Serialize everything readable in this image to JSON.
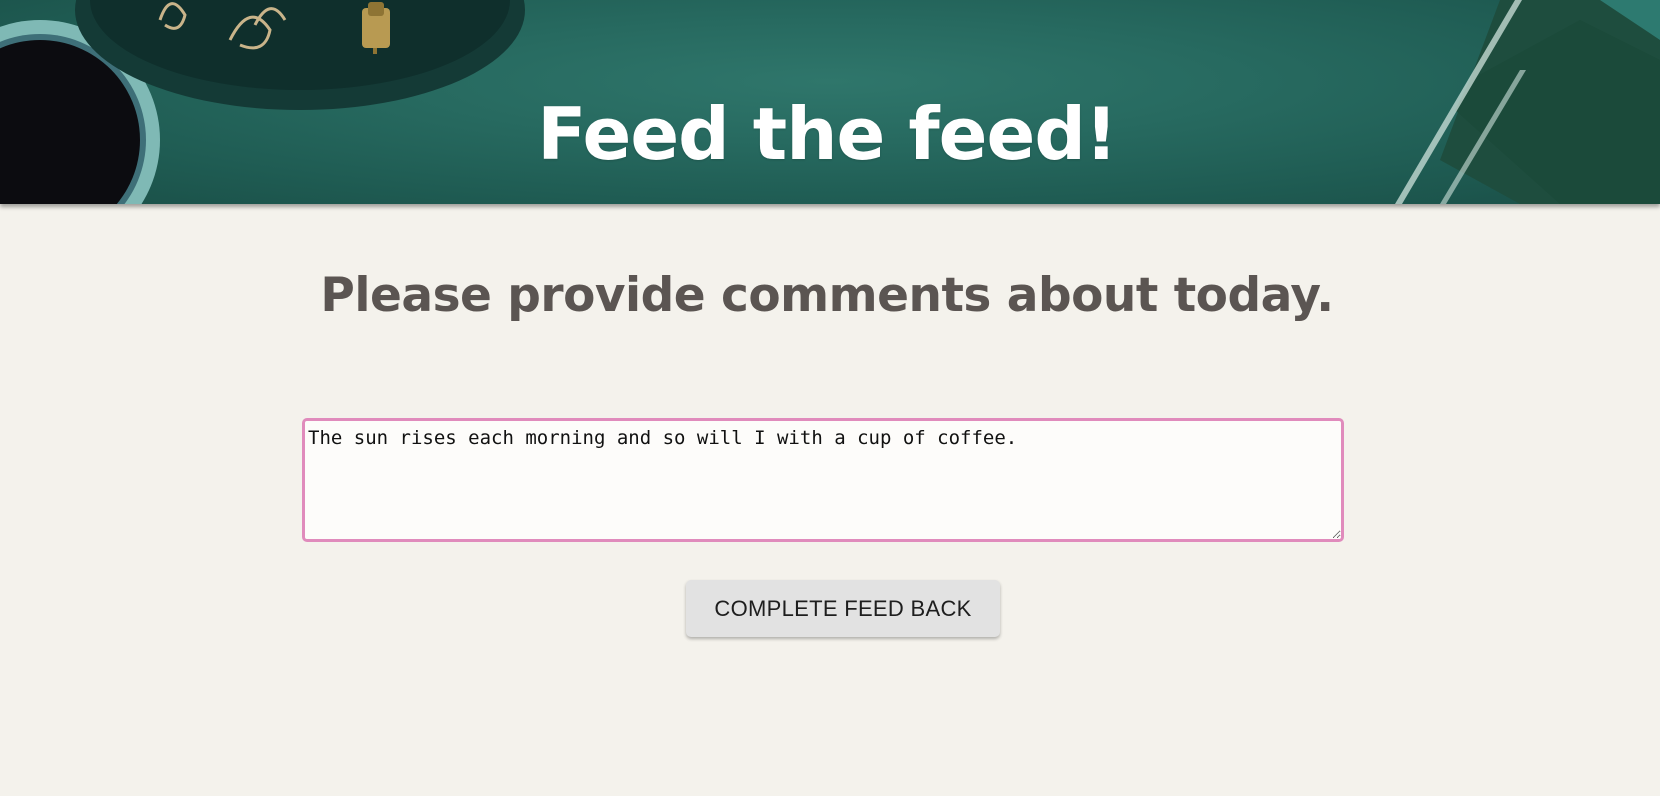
{
  "header": {
    "title": "Feed the feed!"
  },
  "form": {
    "heading": "Please provide comments about today.",
    "comment": {
      "value": "The sun rises each morning and so will I with a cup of coffee."
    },
    "submit_label": "COMPLETE FEED BACK"
  },
  "colors": {
    "banner": "#276a60",
    "page_background": "#f4f2ec",
    "heading_text": "#5b5552",
    "textarea_border": "#e08bbc",
    "button_background": "#e2e2e2"
  }
}
